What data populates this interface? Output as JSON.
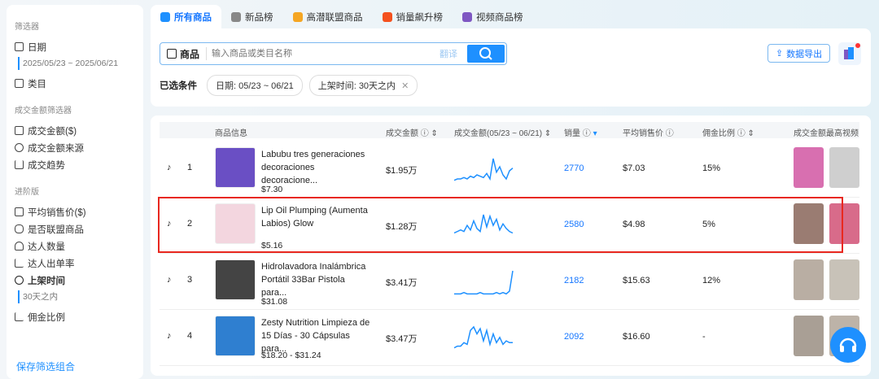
{
  "sidebar": {
    "sec1": "筛选器",
    "date": "日期",
    "date_value": "2025/05/23 ~ 2025/06/21",
    "category": "类目",
    "sec2": "成交金额筛选器",
    "gmv": "成交金额($)",
    "gmv_source": "成交金额来源",
    "gmv_trend": "成交趋势",
    "sec3": "进阶版",
    "avg_price": "平均销售价($)",
    "affiliate": "是否联盟商品",
    "creators": "达人数量",
    "creator_rate": "达人出单率",
    "listed": "上架时间",
    "listed_value": "30天之内",
    "commission": "佣金比例",
    "save": "保存筛选组合"
  },
  "tabs": [
    {
      "label": "所有商品",
      "color": "#1e90ff"
    },
    {
      "label": "新品榜",
      "color": "#888888"
    },
    {
      "label": "高潜联盟商品",
      "color": "#f5a623"
    },
    {
      "label": "销量飙升榜",
      "color": "#f4511e"
    },
    {
      "label": "视频商品榜",
      "color": "#7e57c2"
    }
  ],
  "search": {
    "label": "商品",
    "placeholder": "输入商品或类目名称",
    "translate": "翻译"
  },
  "conditions": {
    "label": "已选条件",
    "chips": [
      "日期: 05/23 ~ 06/21",
      "上架时间: 30天之内"
    ]
  },
  "export": "数据导出",
  "table": {
    "headers": [
      "商品信息",
      "成交金额",
      "成交金额(05/23 ~ 06/21)",
      "销量",
      "平均销售价",
      "佣金比例",
      "成交金额最高视频"
    ],
    "rows": [
      {
        "rank": "1",
        "title": "Labubu tres generaciones decoraciones decoracione...",
        "price": "$7.30",
        "gmv": "$1.95万",
        "sales": "2770",
        "avg": "$7.03",
        "commission": "15%",
        "trend": [
          2,
          3,
          3,
          4,
          3,
          5,
          4,
          6,
          5,
          4,
          7,
          3,
          18,
          8,
          12,
          6,
          3,
          9,
          11
        ],
        "thumb": "#6a4fc4",
        "v1": "#d86fb0",
        "v2": "#cfcfcf"
      },
      {
        "rank": "2",
        "title": "Lip Oil Plumping (Aumenta Labios) Glow",
        "price": "$5.16",
        "gmv": "$1.28万",
        "sales": "2580",
        "avg": "$4.98",
        "commission": "5%",
        "trend": [
          4,
          5,
          6,
          5,
          9,
          6,
          12,
          7,
          5,
          16,
          8,
          15,
          9,
          13,
          6,
          10,
          7,
          5,
          4
        ],
        "thumb": "#f3d6df",
        "v1": "#9a7c72",
        "v2": "#d86b8a"
      },
      {
        "rank": "3",
        "title": "Hidrolavadora Inalámbrica Portátil 33Bar Pistola para...",
        "price": "$31.08",
        "gmv": "$3.41万",
        "sales": "2182",
        "avg": "$15.63",
        "commission": "12%",
        "trend": [
          1,
          1,
          1,
          2,
          1,
          1,
          1,
          1,
          2,
          1,
          1,
          1,
          1,
          2,
          1,
          2,
          1,
          3,
          18
        ],
        "thumb": "#444444",
        "v1": "#b9aea3",
        "v2": "#c8c2b8"
      },
      {
        "rank": "4",
        "title": "Zesty Nutrition Limpieza de 15 Días - 30 Cápsulas para...",
        "price": "$18.20 - $31.24",
        "gmv": "$3.47万",
        "sales": "2092",
        "avg": "$16.60",
        "commission": "-",
        "trend": [
          2,
          3,
          3,
          5,
          4,
          12,
          14,
          10,
          13,
          6,
          12,
          4,
          10,
          5,
          8,
          4,
          6,
          5,
          5
        ],
        "thumb": "#2f7fd0",
        "v1": "#a99f95",
        "v2": "#bdb3a8"
      }
    ]
  }
}
